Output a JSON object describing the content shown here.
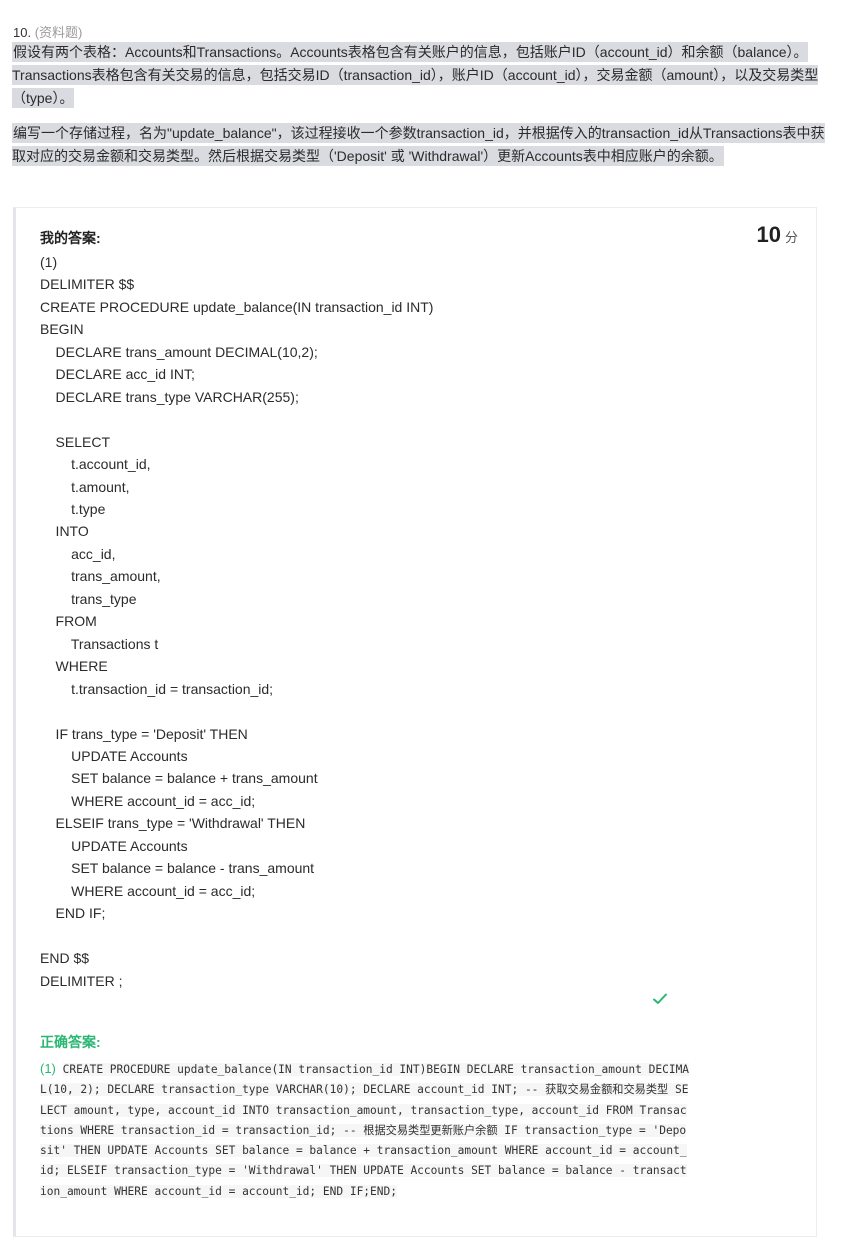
{
  "question": {
    "number": "10.",
    "type": "(资料题)",
    "prompt1": "假设有两个表格：Accounts和Transactions。Accounts表格包含有关账户的信息，包括账户ID（account_id）和余额（balance）。Transactions表格包含有关交易的信息，包括交易ID（transaction_id），账户ID（account_id），交易金额（amount），以及交易类型（type）。",
    "prompt2": "编写一个存储过程，名为\"update_balance\"，该过程接收一个参数transaction_id，并根据传入的transaction_id从Transactions表中获取对应的交易金额和交易类型。然后根据交易类型（'Deposit' 或 'Withdrawal'）更新Accounts表中相应账户的余额。"
  },
  "answer": {
    "label": "我的答案:",
    "score": "10",
    "score_unit": "分",
    "text": "(1)\nDELIMITER $$\nCREATE PROCEDURE update_balance(IN transaction_id INT)\nBEGIN\n    DECLARE trans_amount DECIMAL(10,2);\n    DECLARE acc_id INT;\n    DECLARE trans_type VARCHAR(255);\n\n    SELECT\n        t.account_id,\n        t.amount,\n        t.type\n    INTO\n        acc_id,\n        trans_amount,\n        trans_type\n    FROM\n        Transactions t\n    WHERE\n        t.transaction_id = transaction_id;\n\n    IF trans_type = 'Deposit' THEN\n        UPDATE Accounts\n        SET balance = balance + trans_amount\n        WHERE account_id = acc_id;\n    ELSEIF trans_type = 'Withdrawal' THEN\n        UPDATE Accounts\n        SET balance = balance - trans_amount\n        WHERE account_id = acc_id;\n    END IF;\n\nEND $$\nDELIMITER ;",
    "status_icon": "check-icon",
    "status_color": "#2bb673"
  },
  "correct": {
    "label": "正确答案:",
    "index": "(1)",
    "code": "CREATE PROCEDURE update_balance(IN transaction_id INT)BEGIN    DECLARE transaction_amount DECIMAL(10, 2);    DECLARE transaction_type VARCHAR(10);    DECLARE account_id INT;    -- 获取交易金额和交易类型    SELECT amount, type, account_id INTO transaction_amount, transaction_type, account_id    FROM Transactions    WHERE transaction_id = transaction_id;    -- 根据交易类型更新账户余额    IF transaction_type = 'Deposit' THEN        UPDATE Accounts        SET balance = balance + transaction_amount        WHERE account_id = account_id;    ELSEIF transaction_type = 'Withdrawal' THEN        UPDATE Accounts        SET balance = balance - transaction_amount        WHERE account_id = account_id;    END IF;END;"
  }
}
